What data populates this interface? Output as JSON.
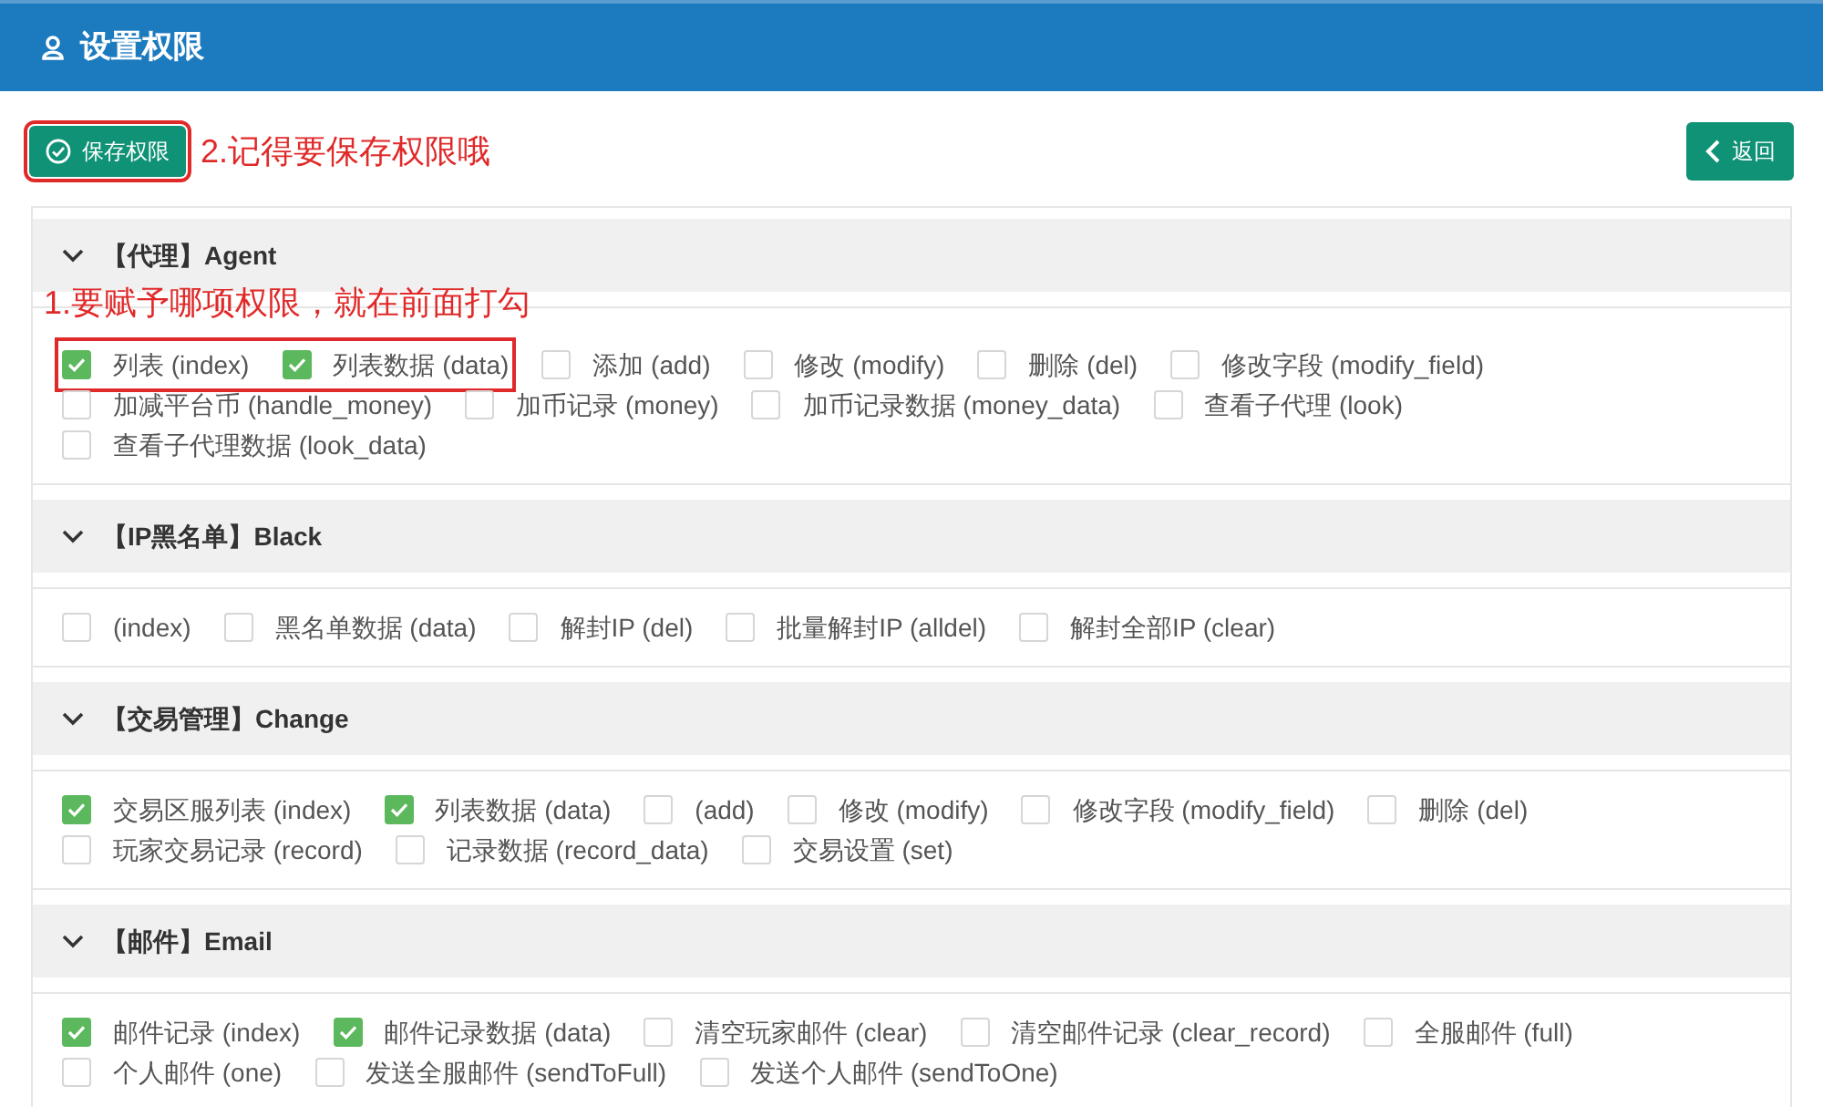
{
  "header": {
    "title": "设置权限"
  },
  "toolbar": {
    "save_button": {
      "label": "保存权限",
      "highlighted": true
    },
    "save_note": "2.记得要保存权限哦",
    "back_button": {
      "label": "返回"
    }
  },
  "sections": [
    {
      "title": "【代理】Agent",
      "expanded": true,
      "annotation": "1.要赋予哪项权限，就在前面打勾",
      "items": [
        {
          "label": "列表 (index)",
          "checked": true,
          "highlighted": true
        },
        {
          "label": "列表数据 (data)",
          "checked": true,
          "highlighted": true
        },
        {
          "label": "添加 (add)",
          "checked": false,
          "highlighted": false
        },
        {
          "label": "修改 (modify)",
          "checked": false,
          "highlighted": false
        },
        {
          "label": "删除 (del)",
          "checked": false,
          "highlighted": false
        },
        {
          "label": "修改字段 (modify_field)",
          "checked": false,
          "highlighted": false
        },
        {
          "label": "加减平台币 (handle_money)",
          "checked": false,
          "highlighted": false
        },
        {
          "label": "加币记录 (money)",
          "checked": false,
          "highlighted": false
        },
        {
          "label": "加币记录数据 (money_data)",
          "checked": false,
          "highlighted": false
        },
        {
          "label": "查看子代理 (look)",
          "checked": false,
          "highlighted": false
        },
        {
          "label": "查看子代理数据 (look_data)",
          "checked": false,
          "highlighted": false
        }
      ]
    },
    {
      "title": "【IP黑名单】Black",
      "expanded": true,
      "items": [
        {
          "label": "(index)",
          "checked": false
        },
        {
          "label": "黑名单数据 (data)",
          "checked": false
        },
        {
          "label": "解封IP (del)",
          "checked": false
        },
        {
          "label": "批量解封IP (alldel)",
          "checked": false
        },
        {
          "label": "解封全部IP (clear)",
          "checked": false
        }
      ]
    },
    {
      "title": "【交易管理】Change",
      "expanded": true,
      "items": [
        {
          "label": "交易区服列表 (index)",
          "checked": true
        },
        {
          "label": "列表数据 (data)",
          "checked": true
        },
        {
          "label": "(add)",
          "checked": false
        },
        {
          "label": "修改 (modify)",
          "checked": false
        },
        {
          "label": "修改字段 (modify_field)",
          "checked": false
        },
        {
          "label": "删除 (del)",
          "checked": false
        },
        {
          "label": "玩家交易记录 (record)",
          "checked": false
        },
        {
          "label": "记录数据 (record_data)",
          "checked": false
        },
        {
          "label": "交易设置 (set)",
          "checked": false
        }
      ]
    },
    {
      "title": "【邮件】Email",
      "expanded": true,
      "items": [
        {
          "label": "邮件记录 (index)",
          "checked": true
        },
        {
          "label": "邮件记录数据 (data)",
          "checked": true
        },
        {
          "label": "清空玩家邮件 (clear)",
          "checked": false
        },
        {
          "label": "清空邮件记录 (clear_record)",
          "checked": false
        },
        {
          "label": "全服邮件 (full)",
          "checked": false
        },
        {
          "label": "个人邮件 (one)",
          "checked": false
        },
        {
          "label": "发送全服邮件 (sendToFull)",
          "checked": false
        },
        {
          "label": "发送个人邮件 (sendToOne)",
          "checked": false
        }
      ]
    }
  ]
}
